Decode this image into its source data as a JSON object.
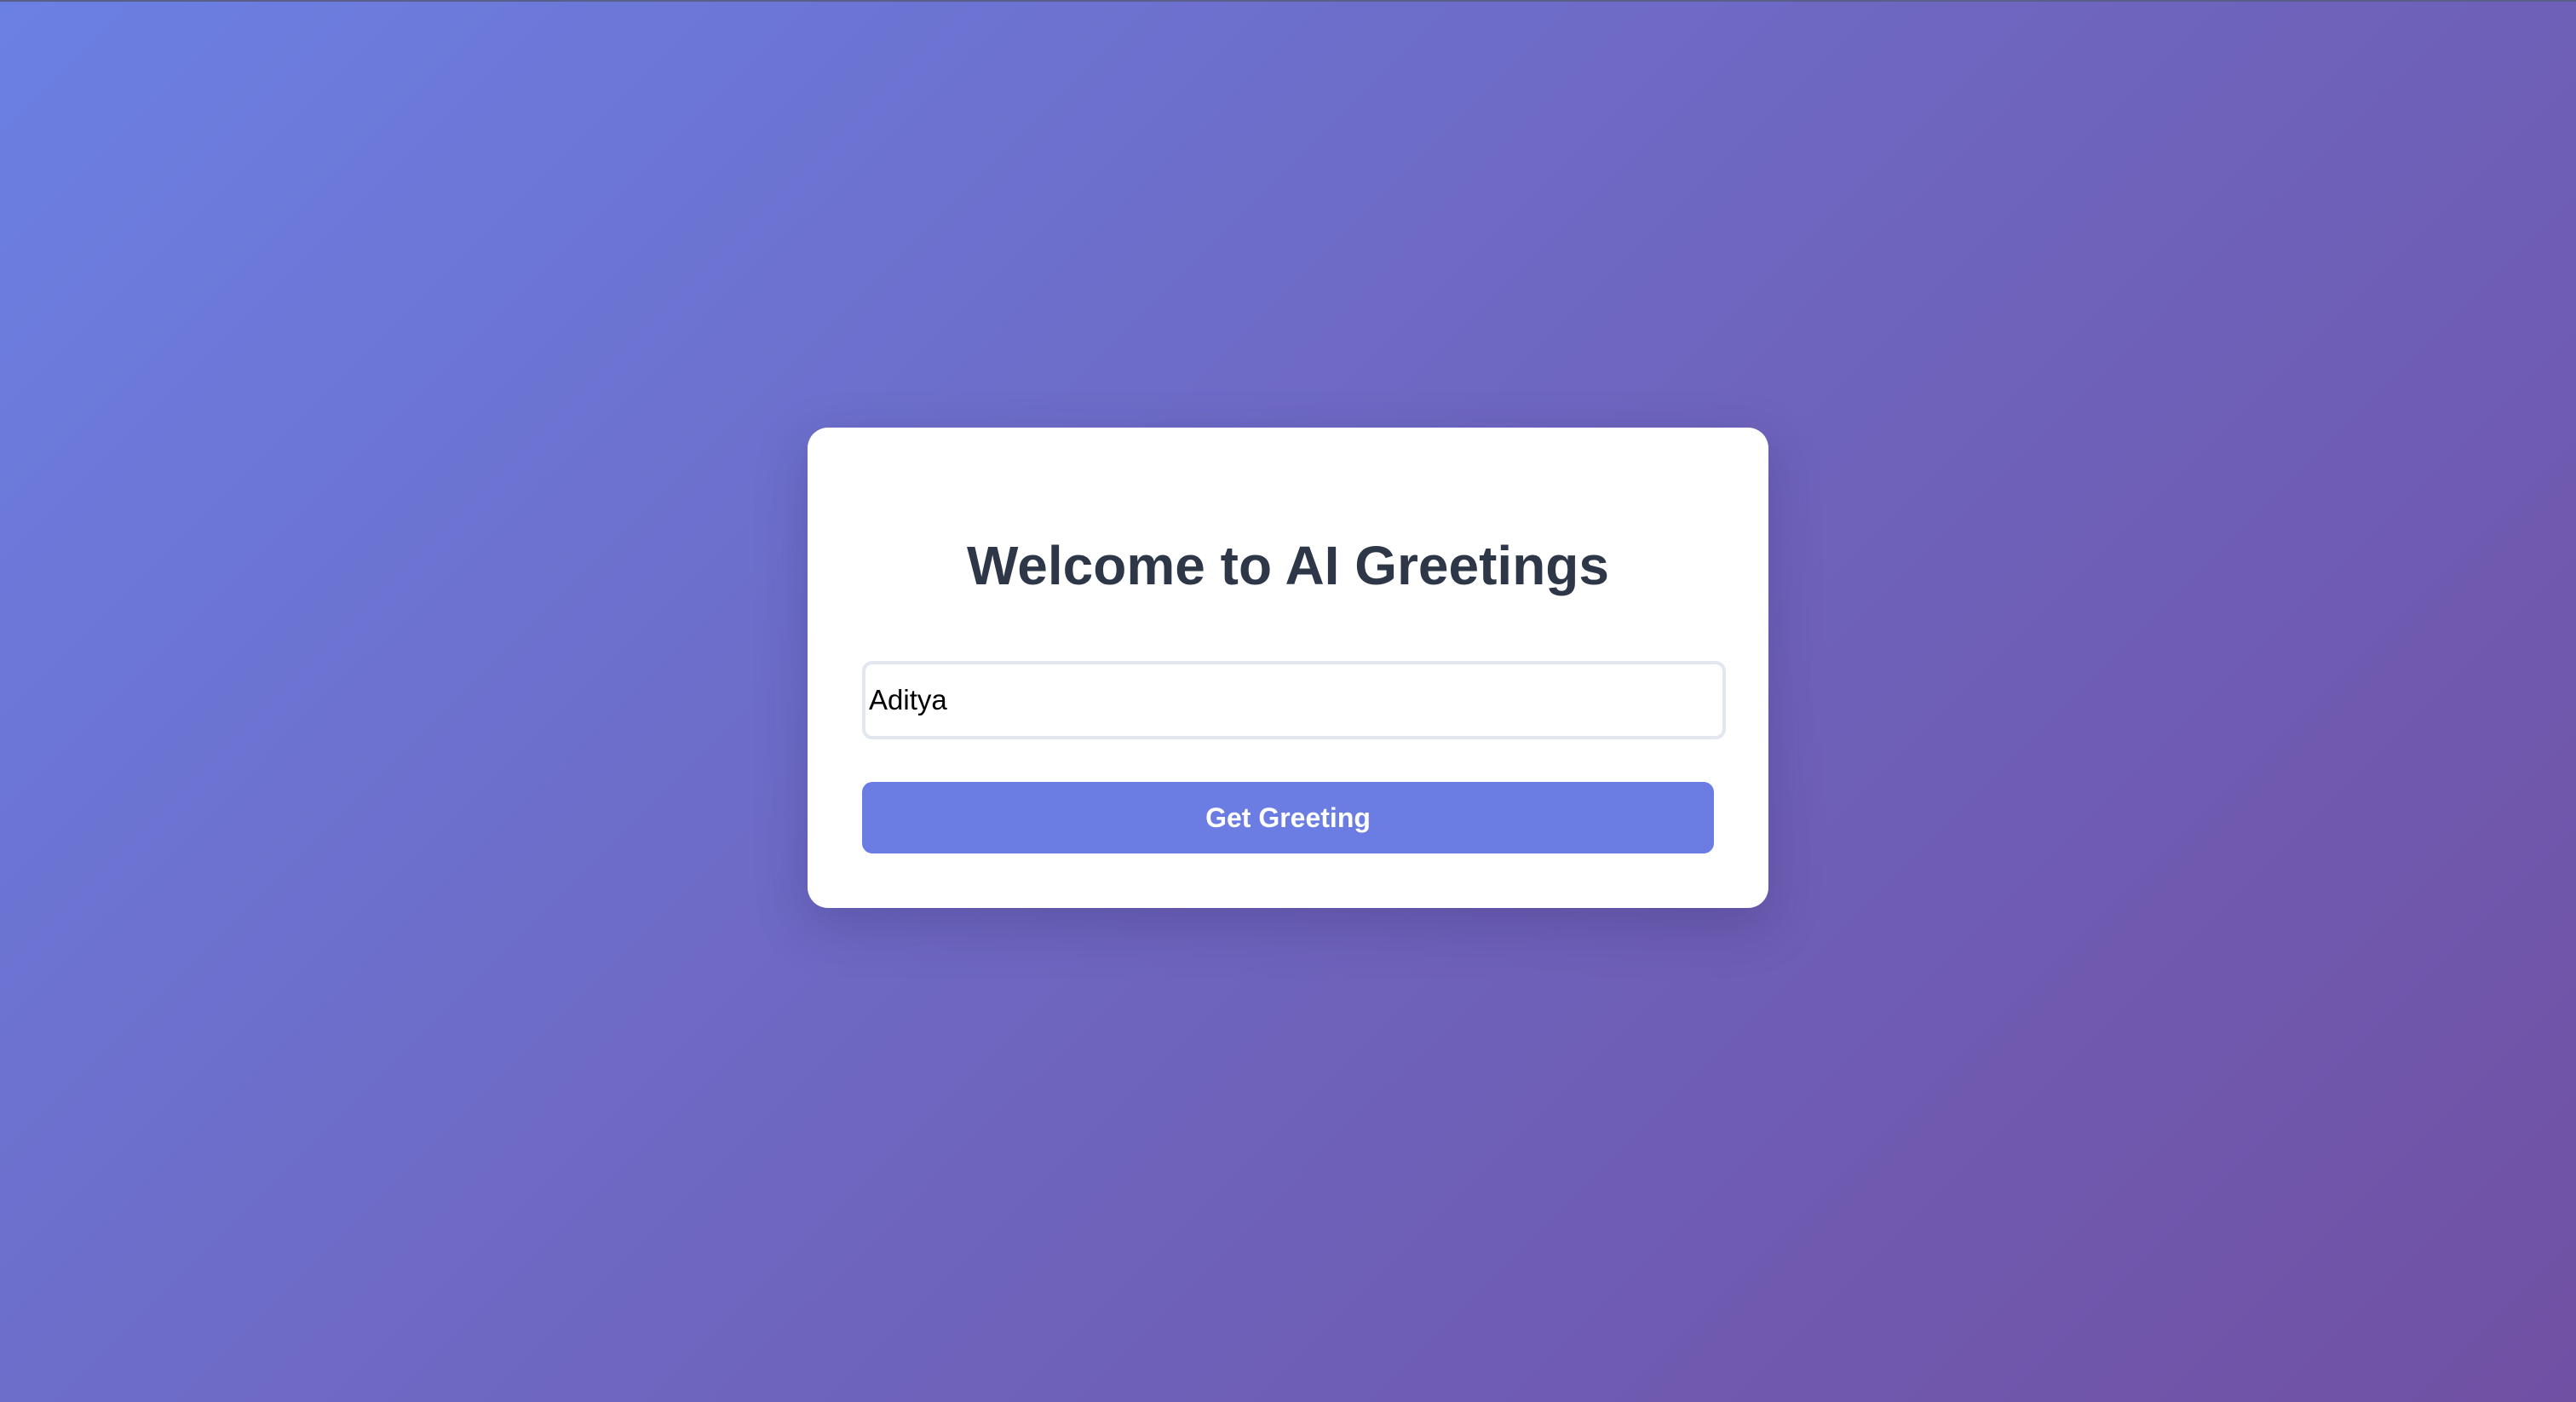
{
  "card": {
    "title": "Welcome to AI Greetings"
  },
  "name_input": {
    "value": "Aditya",
    "placeholder": ""
  },
  "greet_button": {
    "label": "Get Greeting"
  },
  "colors": {
    "background_start": "#6b80e3",
    "background_end": "#7050a3",
    "card": "#ffffff",
    "title": "#2d3748",
    "button": "#6b7de2",
    "button_text": "#ffffff"
  }
}
